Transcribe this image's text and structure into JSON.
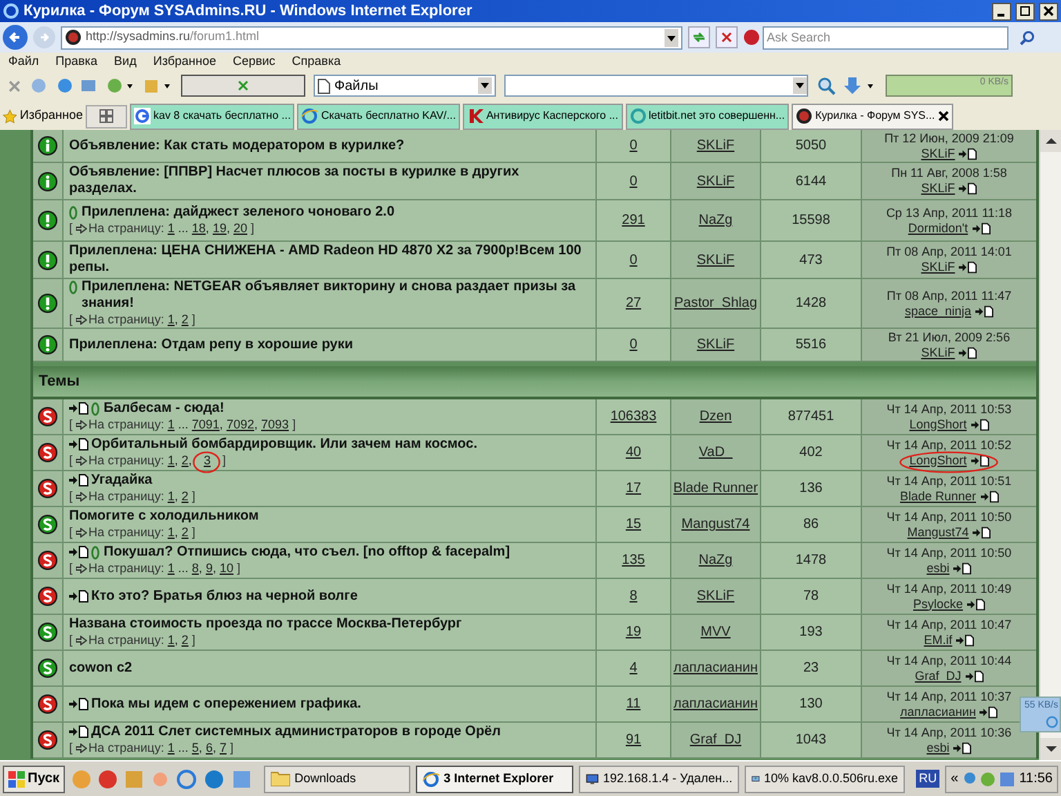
{
  "window": {
    "title": "Курилка - Форум SYSAdmins.RU - Windows Internet Explorer"
  },
  "address": {
    "url_host": "http://sysadmins.ru",
    "url_path": "/forum1.html"
  },
  "search": {
    "placeholder": "Ask Search"
  },
  "menu": [
    "Файл",
    "Правка",
    "Вид",
    "Избранное",
    "Сервис",
    "Справка"
  ],
  "toolbar": {
    "combo": "Файлы",
    "speed": "0 KB/s"
  },
  "favorites": {
    "label": "Избранное"
  },
  "tabs": [
    {
      "label": "kav 8 скачать бесплатно ...",
      "selected": false
    },
    {
      "label": "Скачать бесплатно KAV/...",
      "selected": false
    },
    {
      "label": "Антивирус Касперского ...",
      "selected": false
    },
    {
      "label": "letitbit.net это совершенн...",
      "selected": false
    },
    {
      "label": "Курилка - Форум SYS...",
      "selected": true
    }
  ],
  "sticky_topics": [
    {
      "kind": "info",
      "new": false,
      "attachment": false,
      "title": "Объявление: Как стать модератором в курилке?",
      "replies": "0",
      "author": "SKLiF",
      "views": "5050",
      "last_date": "Пт 12 Июн, 2009 21:09",
      "last_author": "SKLiF"
    },
    {
      "kind": "info",
      "new": false,
      "attachment": false,
      "title": "Объявление: [ППВР] Насчет плюсов за посты в курилке в других разделах.",
      "replies": "0",
      "author": "SKLiF",
      "views": "6144",
      "last_date": "Пн 11 Авг, 2008 1:58",
      "last_author": "SKLiF"
    },
    {
      "kind": "sticky",
      "new": false,
      "attachment": true,
      "title": "Прилеплена: дайджест зеленого чоноваго 2.0",
      "pager": {
        "open": "[",
        "label": "На страницу:",
        "links": [
          {
            "t": "1",
            "sep": "..."
          },
          {
            "t": "18",
            "sep": ","
          },
          {
            "t": "19",
            "sep": ","
          },
          {
            "t": "20"
          }
        ],
        "close": "]"
      },
      "replies": "291",
      "author": "NaZg",
      "views": "15598",
      "last_date": "Ср 13 Апр, 2011 11:18",
      "last_author": "Dormidon't"
    },
    {
      "kind": "sticky",
      "new": false,
      "attachment": false,
      "title": "Прилеплена: ЦЕНА СНИЖЕНА - AMD Radeon HD 4870 X2 за 7900р!Всем 100 репы.",
      "replies": "0",
      "author": "SKLiF",
      "views": "473",
      "last_date": "Пт 08 Апр, 2011 14:01",
      "last_author": "SKLiF"
    },
    {
      "kind": "sticky",
      "new": false,
      "attachment": true,
      "title": "Прилеплена: NETGEAR объявляет викторину и снова раздает призы за знания!",
      "pager": {
        "open": "[",
        "label": "На страницу:",
        "links": [
          {
            "t": "1",
            "sep": ","
          },
          {
            "t": "2"
          }
        ],
        "close": "]"
      },
      "replies": "27",
      "author": "Pastor_Shlag",
      "views": "1428",
      "last_date": "Пт 08 Апр, 2011 11:47",
      "last_author": "space_ninja"
    },
    {
      "kind": "sticky",
      "new": false,
      "attachment": false,
      "title": "Прилеплена: Отдам репу в хорошие руки",
      "replies": "0",
      "author": "SKLiF",
      "views": "5516",
      "last_date": "Вт 21 Июл, 2009 2:56",
      "last_author": "SKLiF"
    }
  ],
  "section": {
    "title": "Темы"
  },
  "topics": [
    {
      "kind": "hot",
      "circled": false,
      "new": true,
      "attachment": true,
      "title": "Балбесам - сюда!",
      "pager": {
        "open": "[",
        "label": "На страницу:",
        "links": [
          {
            "t": "1",
            "sep": "..."
          },
          {
            "t": "7091",
            "sep": ","
          },
          {
            "t": "7092",
            "sep": ","
          },
          {
            "t": "7093"
          }
        ],
        "close": "]"
      },
      "replies": "106383",
      "author": "Dzen",
      "views": "877451",
      "last_date": "Чт 14 Апр, 2011 10:53",
      "last_author": "LongShort"
    },
    {
      "kind": "hot",
      "circled": true,
      "new": true,
      "attachment": false,
      "title": "Орбитальный бомбардировщик. Или зачем нам космос.",
      "pager": {
        "open": "[",
        "label": "На страницу:",
        "links": [
          {
            "t": "1",
            "sep": ","
          },
          {
            "t": "2",
            "sep": ","
          },
          {
            "t": "3"
          }
        ],
        "close": "]"
      },
      "replies": "40",
      "author": "VaD_",
      "views": "402",
      "last_date": "Чт 14 Апр, 2011 10:52",
      "last_author": "LongShort"
    },
    {
      "kind": "hot",
      "circled": false,
      "new": true,
      "attachment": false,
      "title": "Угадайка",
      "pager": {
        "open": "[",
        "label": "На страницу:",
        "links": [
          {
            "t": "1",
            "sep": ","
          },
          {
            "t": "2"
          }
        ],
        "close": "]"
      },
      "replies": "17",
      "author": "Blade Runner",
      "views": "136",
      "last_date": "Чт 14 Апр, 2011 10:51",
      "last_author": "Blade Runner"
    },
    {
      "kind": "normal",
      "circled": false,
      "new": false,
      "attachment": false,
      "title": "Помогите с холодильником",
      "pager": {
        "open": "[",
        "label": "На страницу:",
        "links": [
          {
            "t": "1",
            "sep": ","
          },
          {
            "t": "2"
          }
        ],
        "close": "]"
      },
      "replies": "15",
      "author": "Mangust74",
      "views": "86",
      "last_date": "Чт 14 Апр, 2011 10:50",
      "last_author": "Mangust74"
    },
    {
      "kind": "hot",
      "circled": false,
      "new": true,
      "attachment": true,
      "title": "Покушал? Отпишись сюда, что съел. [no offtop & facepalm]",
      "pager": {
        "open": "[",
        "label": "На страницу:",
        "links": [
          {
            "t": "1",
            "sep": "..."
          },
          {
            "t": "8",
            "sep": ","
          },
          {
            "t": "9",
            "sep": ","
          },
          {
            "t": "10"
          }
        ],
        "close": "]"
      },
      "replies": "135",
      "author": "NaZg",
      "views": "1478",
      "last_date": "Чт 14 Апр, 2011 10:50",
      "last_author": "esbi"
    },
    {
      "kind": "hot",
      "circled": false,
      "new": true,
      "attachment": false,
      "title": "Кто это? Братья блюз на черной волге",
      "replies": "8",
      "author": "SKLiF",
      "views": "78",
      "last_date": "Чт 14 Апр, 2011 10:49",
      "last_author": "Psylocke"
    },
    {
      "kind": "normal",
      "circled": false,
      "new": false,
      "attachment": false,
      "title": "Названа стоимость проезда по трассе Москва-Петербург",
      "pager": {
        "open": "[",
        "label": "На страницу:",
        "links": [
          {
            "t": "1",
            "sep": ","
          },
          {
            "t": "2"
          }
        ],
        "close": "]"
      },
      "replies": "19",
      "author": "MVV",
      "views": "193",
      "last_date": "Чт 14 Апр, 2011 10:47",
      "last_author": "EM.if"
    },
    {
      "kind": "normal",
      "circled": false,
      "new": false,
      "attachment": false,
      "title": "cowon c2",
      "replies": "4",
      "author": "лапласианин",
      "views": "23",
      "last_date": "Чт 14 Апр, 2011 10:44",
      "last_author": "Graf_DJ"
    },
    {
      "kind": "hot",
      "circled": false,
      "new": true,
      "attachment": false,
      "title": "Пока мы идем с опережением графика.",
      "replies": "11",
      "author": "лапласианин",
      "views": "130",
      "last_date": "Чт 14 Апр, 2011 10:37",
      "last_author": "лапласианин"
    },
    {
      "kind": "hot",
      "circled": false,
      "new": true,
      "attachment": false,
      "title": "ДСА 2011 Слет системных администраторов в городе Орёл",
      "pager": {
        "open": "[",
        "label": "На страницу:",
        "links": [
          {
            "t": "1",
            "sep": "..."
          },
          {
            "t": "5",
            "sep": ","
          },
          {
            "t": "6",
            "sep": ","
          },
          {
            "t": "7"
          }
        ],
        "close": "]"
      },
      "replies": "91",
      "author": "Graf_DJ",
      "views": "1043",
      "last_date": "Чт 14 Апр, 2011 10:36",
      "last_author": "esbi"
    }
  ],
  "net_meter": {
    "speed": "55 KB/s"
  },
  "taskbar": {
    "start": "Пуск",
    "buttons": [
      {
        "label": "Downloads",
        "selected": false
      },
      {
        "label": "3 Internet Explorer",
        "selected": true
      },
      {
        "label": "192.168.1.4 - Удален...",
        "selected": false
      },
      {
        "label": "10% kav8.0.0.506ru.exe",
        "selected": false
      }
    ],
    "lang": "RU",
    "tray_toggle": "«",
    "clock": "11:56"
  }
}
